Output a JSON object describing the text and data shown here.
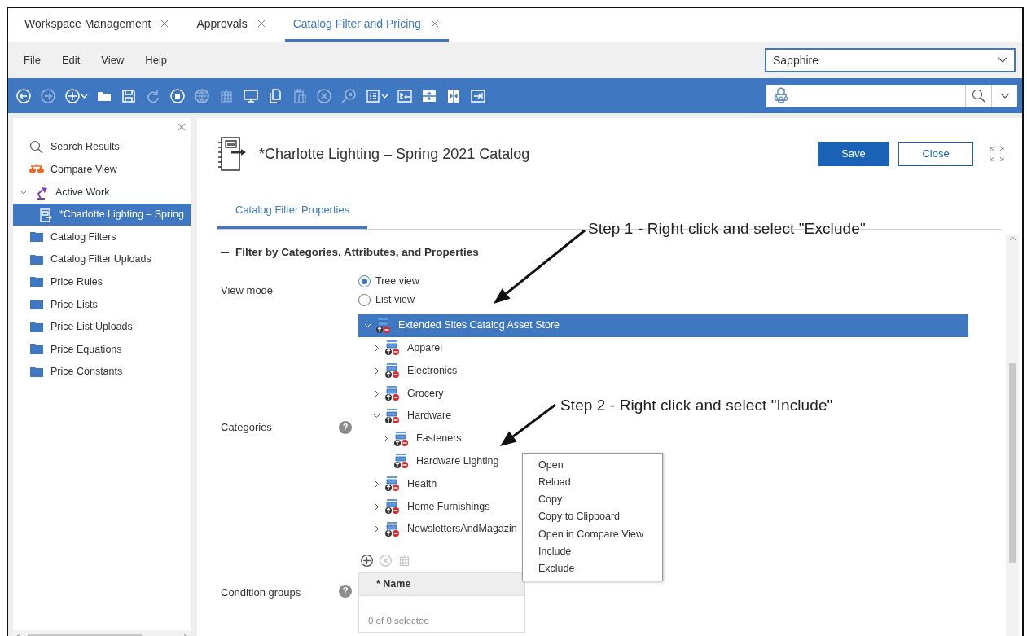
{
  "tabs": [
    {
      "label": "Workspace Management",
      "selected": false
    },
    {
      "label": "Approvals",
      "selected": false
    },
    {
      "label": "Catalog Filter and Pricing",
      "selected": true
    }
  ],
  "menu": [
    "File",
    "Edit",
    "View",
    "Help"
  ],
  "store_select": {
    "value": "Sapphire"
  },
  "toolbar": [
    {
      "kind": "back",
      "disabled": false,
      "dropdown": false
    },
    {
      "kind": "forward",
      "disabled": true,
      "dropdown": false
    },
    {
      "kind": "add",
      "disabled": false,
      "dropdown": true
    },
    {
      "kind": "folder",
      "disabled": false,
      "dropdown": false
    },
    {
      "kind": "save",
      "disabled": false,
      "dropdown": false
    },
    {
      "kind": "redo",
      "disabled": true,
      "dropdown": false
    },
    {
      "kind": "stop",
      "disabled": false,
      "dropdown": false
    },
    {
      "kind": "globe",
      "disabled": true,
      "dropdown": false
    },
    {
      "kind": "columns",
      "disabled": true,
      "dropdown": false
    },
    {
      "kind": "monitor",
      "disabled": false,
      "dropdown": false
    },
    {
      "kind": "copy",
      "disabled": false,
      "dropdown": false
    },
    {
      "kind": "paste",
      "disabled": true,
      "dropdown": false
    },
    {
      "kind": "cancel",
      "disabled": true,
      "dropdown": false
    },
    {
      "kind": "find",
      "disabled": true,
      "dropdown": false
    },
    {
      "kind": "list",
      "disabled": false,
      "dropdown": true
    },
    {
      "kind": "tree",
      "disabled": false,
      "dropdown": false
    },
    {
      "kind": "split-v",
      "disabled": false,
      "dropdown": false
    },
    {
      "kind": "split-h",
      "disabled": false,
      "dropdown": false
    },
    {
      "kind": "export",
      "disabled": false,
      "dropdown": false
    }
  ],
  "sidebar": {
    "items": [
      {
        "label": "Search Results",
        "kind": "search",
        "selected": false
      },
      {
        "label": "Compare View",
        "kind": "compare",
        "selected": false
      },
      {
        "label": "Active Work",
        "kind": "active",
        "selected": false,
        "expanded": true,
        "children": [
          {
            "label": "*Charlotte Lighting – Spring",
            "kind": "document",
            "selected": true
          }
        ]
      },
      {
        "label": "Catalog Filters",
        "kind": "folder",
        "selected": false
      },
      {
        "label": "Catalog Filter Uploads",
        "kind": "folder",
        "selected": false
      },
      {
        "label": "Price Rules",
        "kind": "folder",
        "selected": false
      },
      {
        "label": "Price Lists",
        "kind": "folder",
        "selected": false
      },
      {
        "label": "Price List Uploads",
        "kind": "folder",
        "selected": false
      },
      {
        "label": "Price Equations",
        "kind": "folder",
        "selected": false
      },
      {
        "label": "Price Constants",
        "kind": "folder",
        "selected": false
      }
    ]
  },
  "editor": {
    "title": "*Charlotte Lighting – Spring 2021 Catalog",
    "buttons": [
      {
        "label": "Save",
        "kind": "primary"
      },
      {
        "label": "Close",
        "kind": "secondary"
      }
    ],
    "tabs": [
      {
        "label": "Catalog Filter Properties",
        "selected": true
      }
    ],
    "section": {
      "title": "Filter by Categories, Attributes, and Properties",
      "expanded": true
    },
    "view_mode": {
      "label": "View mode",
      "options": [
        {
          "label": "Tree view",
          "selected": true
        },
        {
          "label": "List view",
          "selected": false
        }
      ]
    },
    "categories": {
      "label": "Categories",
      "help": "?",
      "tree": [
        {
          "label": "Extended Sites Catalog Asset Store",
          "kind": "branch",
          "expanded": true,
          "selected": true,
          "children": [
            {
              "label": "Apparel",
              "kind": "branch",
              "expanded": false,
              "selected": false
            },
            {
              "label": "Electronics",
              "kind": "branch",
              "expanded": false,
              "selected": false
            },
            {
              "label": "Grocery",
              "kind": "branch",
              "expanded": false,
              "selected": false
            },
            {
              "label": "Hardware",
              "kind": "branch",
              "expanded": true,
              "selected": false,
              "children": [
                {
                  "label": "Fasteners",
                  "kind": "branch",
                  "expanded": false,
                  "selected": false
                },
                {
                  "label": "Hardware Lighting",
                  "kind": "leaf",
                  "selected": false
                }
              ]
            },
            {
              "label": "Health",
              "kind": "branch",
              "expanded": false,
              "selected": false
            },
            {
              "label": "Home Furnishings",
              "kind": "branch",
              "expanded": false,
              "selected": false
            },
            {
              "label": "NewslettersAndMagazin",
              "kind": "branch",
              "expanded": false,
              "selected": false
            }
          ]
        }
      ]
    },
    "condition_groups": {
      "label": "Condition groups",
      "help": "?",
      "tools": [
        {
          "kind": "add",
          "disabled": false
        },
        {
          "kind": "cancel",
          "disabled": true
        },
        {
          "kind": "columns",
          "disabled": true
        }
      ],
      "columns": [
        "* Name"
      ],
      "footer": "0 of 0 selected"
    }
  },
  "context_menu": {
    "items": [
      "Open",
      "Reload",
      "Copy",
      "Copy to Clipboard",
      "Open in Compare View",
      "Include",
      "Exclude"
    ]
  },
  "annotations": [
    {
      "text": "Step 1 - Right click and select \"Exclude\""
    },
    {
      "text": "Step 2 - Right click and select \"Include\""
    }
  ]
}
